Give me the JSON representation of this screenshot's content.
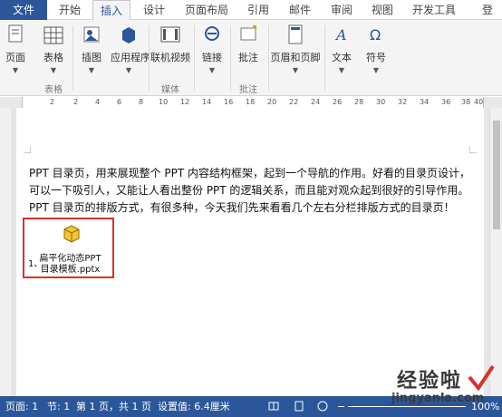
{
  "tabs": [
    {
      "label": "文件"
    },
    {
      "label": "开始"
    },
    {
      "label": "插入"
    },
    {
      "label": "设计"
    },
    {
      "label": "页面布局"
    },
    {
      "label": "引用"
    },
    {
      "label": "邮件"
    },
    {
      "label": "审阅"
    },
    {
      "label": "视图"
    },
    {
      "label": "开发工具"
    },
    {
      "label": "登"
    }
  ],
  "ribbon": {
    "pages": {
      "label": "页面"
    },
    "table": {
      "label": "表格"
    },
    "illustrations": {
      "label": "插图"
    },
    "apps": {
      "label": "应用程序"
    },
    "online_video": {
      "label": "联机视频"
    },
    "links": {
      "label": "链接"
    },
    "comment": {
      "label": "批注"
    },
    "header_footer": {
      "label": "页眉和页脚"
    },
    "text": {
      "label": "文本"
    },
    "symbols": {
      "label": "符号"
    },
    "groups": {
      "table": "表格",
      "media": "媒体",
      "comments": "批注"
    }
  },
  "ruler": {
    "numbers": [
      "2",
      "2",
      "4",
      "6",
      "8",
      "10",
      "12",
      "14",
      "16",
      "18",
      "20",
      "22",
      "24",
      "26",
      "28",
      "30",
      "32",
      "34",
      "36",
      "38",
      "40"
    ]
  },
  "document": {
    "paragraph_lines": [
      "PPT 目录页，用来展现整个 PPT 内容结构框架，起到一个导航的作用。好看的目录页设计，",
      "可以一下吸引人，又能让人看出整份 PPT 的逻辑关系，而且能对观众起到很好的引导作用。",
      "PPT 目录页的排版方式，有很多种，今天我们先来看看几个左右分栏排版方式的目录页！"
    ],
    "object_number": "1、",
    "object_name_1": "扁平化动态PPT",
    "object_name_2": "目录模板.pptx"
  },
  "status": {
    "page": "页面: 1",
    "section": "节: 1",
    "page_of": "第 1 页，共 1 页",
    "setting": "设置值: 6.4厘米",
    "zoom": "100%"
  },
  "watermark": {
    "line1": "经验啦",
    "line2": "jingyanla.com"
  },
  "colors": {
    "file_tab": "#2b579a",
    "statusbar": "#2b579a",
    "highlight_border": "#d9302a"
  }
}
